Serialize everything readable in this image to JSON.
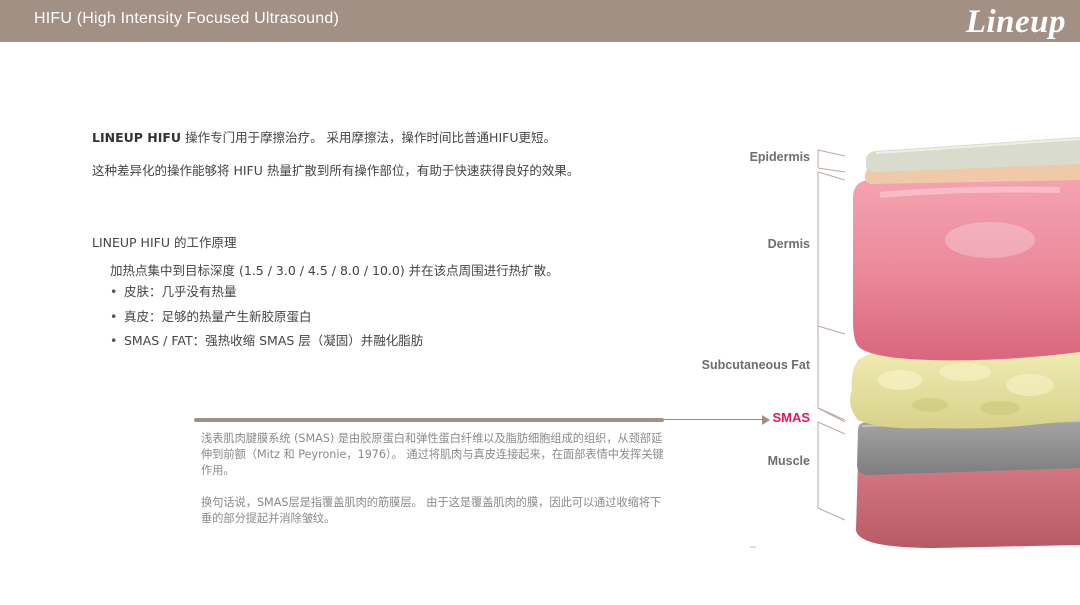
{
  "header": {
    "title": "HIFU (High Intensity Focused Ultrasound)",
    "logo_text": "Lineup"
  },
  "intro": {
    "line1_bold": "LINEUP HIFU",
    "line1_rest": " 操作专门用于摩擦治疗。 采用摩擦法，操作时间比普通HIFU更短。",
    "line2": "这种差异化的操作能够将 HIFU 热量扩散到所有操作部位，有助于快速获得良好的效果。"
  },
  "principle": {
    "title": "LINEUP HIFU 的工作原理",
    "description": "加热点集中到目标深度 (1.5 / 3.0 / 4.5 / 8.0 / 10.0) 并在该点周围进行热扩散。",
    "bullets": [
      "皮肤：几乎没有热量",
      "真皮：足够的热量产生新胶原蛋白",
      "SMAS / FAT：强热收缩 SMAS 层（凝固）并融化脂肪"
    ]
  },
  "smas_note": {
    "paragraph1": "浅表肌肉腱膜系统 (SMAS) 是由胶原蛋白和弹性蛋白纤维以及脂肪细胞组成的组织，从颈部延伸到前额（Mitz 和 Peyronie，1976）。 通过将肌肉与真皮连接起来，在面部表情中发挥关键作用。",
    "paragraph2": "换句话说，SMAS层是指覆盖肌肉的筋膜层。 由于这是覆盖肌肉的膜，因此可以通过收缩将下垂的部分提起并消除皱纹。"
  },
  "layers": {
    "epidermis": "Epidermis",
    "dermis": "Dermis",
    "subcutaneous_fat": "Subcutaneous Fat",
    "smas": "SMAS",
    "muscle": "Muscle"
  },
  "colors": {
    "header_bg": "#a39085",
    "smas_accent": "#e3165b",
    "epidermis": "#d9dccd",
    "dermis": "#ec8a9c",
    "fat": "#e7e3a0",
    "smas_layer": "#8e8e8e",
    "muscle": "#c96a72"
  }
}
